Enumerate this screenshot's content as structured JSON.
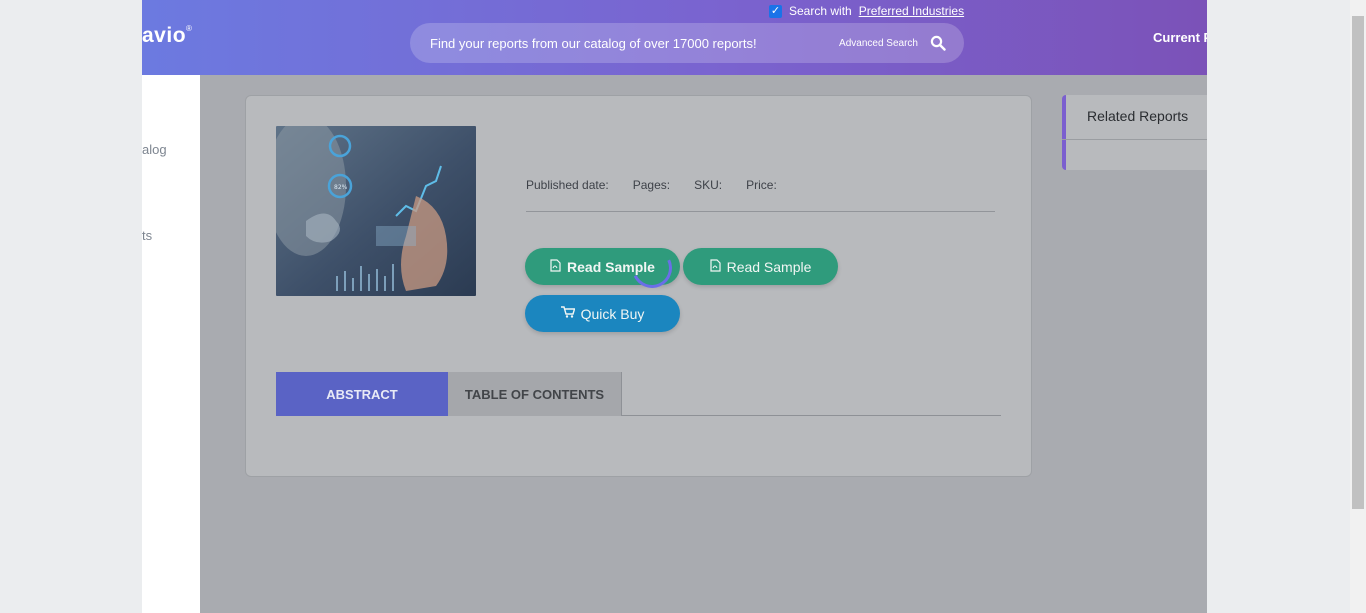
{
  "header": {
    "logo_text": "avio",
    "logo_mark": "®",
    "preferred_prefix": "Search with",
    "preferred_link": "Preferred Industries",
    "search_placeholder": "Find your reports from our catalog of over 17000 reports!",
    "advanced_search": "Advanced Search",
    "current_link": "Current Pl"
  },
  "sidebar": {
    "items": [
      {
        "label": "alog"
      },
      {
        "label": "ts"
      }
    ]
  },
  "report": {
    "meta": {
      "published_label": "Published date:",
      "pages_label": "Pages:",
      "sku_label": "SKU:",
      "price_label": "Price:"
    },
    "buttons": {
      "read_sample_primary": "Read Sample",
      "read_sample_secondary": "Read Sample",
      "quick_buy": "Quick Buy"
    },
    "tabs": [
      {
        "label": "ABSTRACT",
        "active": true
      },
      {
        "label": "TABLE OF CONTENTS",
        "active": false
      }
    ]
  },
  "related": {
    "title": "Related Reports"
  },
  "colors": {
    "header_start": "#6c7ae0",
    "header_end": "#7b52b8",
    "button_green": "#2f9b7c",
    "button_blue": "#1b86bf",
    "tab_active": "#5a63c5"
  },
  "icons": [
    "search-icon",
    "pdf-icon",
    "cart-icon",
    "checkbox-checked-icon",
    "loading-spinner-icon"
  ]
}
